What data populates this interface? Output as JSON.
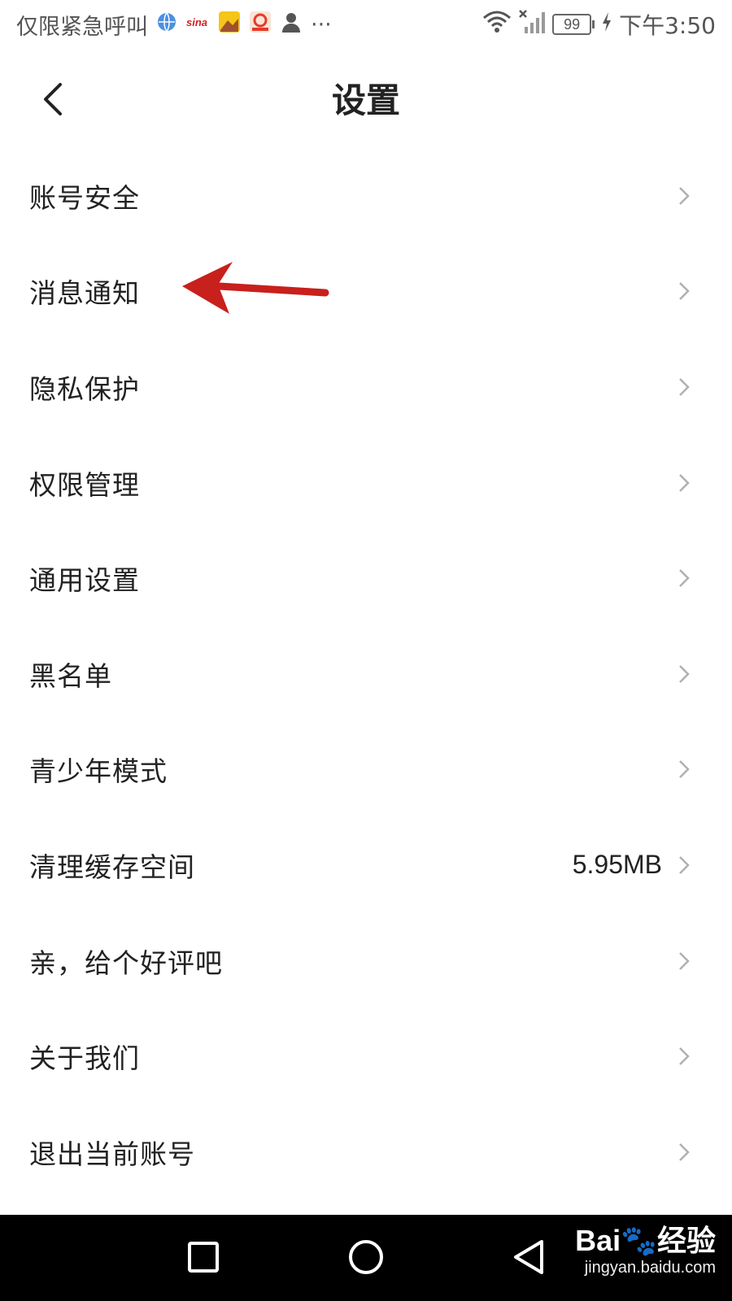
{
  "status_bar": {
    "carrier_text": "仅限紧急呼叫",
    "more": "···",
    "battery": "99",
    "time": "下午3:50",
    "app_icons": [
      "browser-icon",
      "sina-icon",
      "sohu-news-icon",
      "netease-icon",
      "person-icon"
    ]
  },
  "header": {
    "title": "设置",
    "back_icon": "chevron-left-icon"
  },
  "settings": {
    "items": [
      {
        "label": "账号安全",
        "value": ""
      },
      {
        "label": "消息通知",
        "value": ""
      },
      {
        "label": "隐私保护",
        "value": ""
      },
      {
        "label": "权限管理",
        "value": ""
      },
      {
        "label": "通用设置",
        "value": ""
      },
      {
        "label": "黑名单",
        "value": ""
      },
      {
        "label": "青少年模式",
        "value": ""
      },
      {
        "label": "清理缓存空间",
        "value": "5.95MB"
      },
      {
        "label": "亲，给个好评吧",
        "value": ""
      },
      {
        "label": "关于我们",
        "value": ""
      },
      {
        "label": "退出当前账号",
        "value": ""
      }
    ]
  },
  "annotation": {
    "color": "#c8201c"
  },
  "nav_bar": {
    "buttons": [
      "square-icon",
      "circle-icon",
      "triangle-back-icon"
    ],
    "background": "#000000"
  },
  "watermark": {
    "logo": "Bai🐾经验",
    "url": "jingyan.baidu.com"
  }
}
